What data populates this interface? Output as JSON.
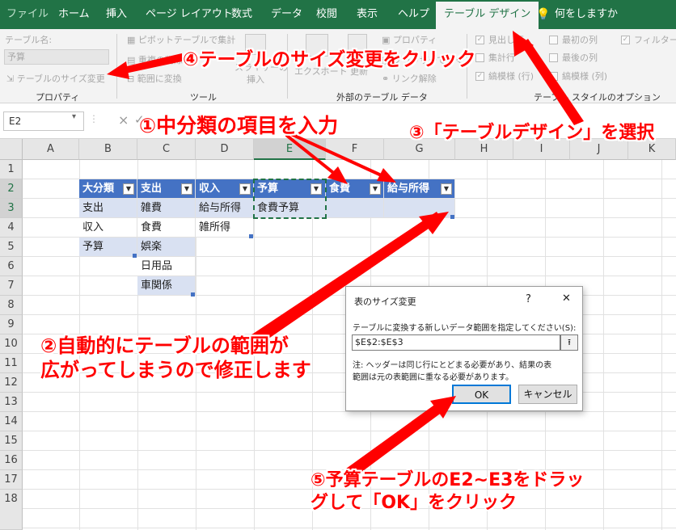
{
  "ribbon": {
    "tabs": [
      "ファイル",
      "ホーム",
      "挿入",
      "ページ レイアウト",
      "数式",
      "データ",
      "校閲",
      "表示",
      "ヘルプ",
      "テーブル デザイン"
    ],
    "tell_me": "何をしますか",
    "table_name_label": "テーブル名:",
    "table_name_value": "予算",
    "resize_label": "テーブルのサイズ変更",
    "group_properties": "プロパティ",
    "pivot_label": "ピボットテーブルで集計",
    "remove_dup_label": "重複の削除",
    "convert_label": "範囲に変換",
    "slicer_label_1": "スライサーの",
    "slicer_label_2": "挿入",
    "group_tools": "ツール",
    "export_label": "エクスポート",
    "refresh_label": "更新",
    "properties_btn": "プロパティ",
    "open_browser_label": "ブラウザーで開く",
    "unlink_label": "リンク解除",
    "group_external": "外部のテーブル データ",
    "opt_header": "見出し行",
    "opt_total": "集計行",
    "opt_banded_rows": "縞模様 (行)",
    "opt_first_col": "最初の列",
    "opt_last_col": "最後の列",
    "opt_banded_cols": "縞模様 (列)",
    "opt_filter": "フィルター ボタン",
    "group_options": "テーブル スタイルのオプション"
  },
  "formula_bar": {
    "name_box": "E2",
    "cancel": "×",
    "confirm": "✓",
    "fx": "fx"
  },
  "grid": {
    "columns": [
      "A",
      "B",
      "C",
      "D",
      "E",
      "F",
      "G",
      "H",
      "I",
      "J",
      "K"
    ],
    "rows": [
      "1",
      "2",
      "3",
      "4",
      "5",
      "6",
      "7",
      "8",
      "9",
      "10",
      "11",
      "12",
      "13",
      "14",
      "15",
      "16",
      "17",
      "18"
    ],
    "cells": {
      "B2": "大分類",
      "C2": "支出",
      "D2": "収入",
      "E2": "予算",
      "F2": "食費",
      "G2": "給与所得",
      "B3": "支出",
      "B4": "収入",
      "B5": "予算",
      "C3": "雑費",
      "C4": "食費",
      "C5": "娯楽",
      "C6": "日用品",
      "C7": "車関係",
      "D3": "給与所得",
      "D4": "雑所得",
      "E3": "食費予算"
    }
  },
  "dialog": {
    "title": "表のサイズ変更",
    "help": "?",
    "close": "✕",
    "prompt": "テーブルに変換する新しいデータ範囲を指定してください(S):",
    "range_value": "$E$2:$E$3",
    "note_line1": "注: ヘッダーは同じ行にとどまる必要があり、結果の表",
    "note_line2": "範囲は元の表範囲に重なる必要があります。",
    "ok": "OK",
    "cancel": "キャンセル"
  },
  "annotations": {
    "step1": "①中分類の項目を入力",
    "step2_line1": "②自動的にテーブルの範囲が",
    "step2_line2": "広がってしまうので修正します",
    "step3": "③「テーブルデザイン」を選択",
    "step4": "④テーブルのサイズ変更をクリック",
    "step5_line1": "⑤予算テーブルのE2~E3をドラッ",
    "step5_line2": "グして「OK」をクリック"
  },
  "colors": {
    "excel_green": "#217346",
    "table_header": "#4472c4",
    "table_band": "#d9e1f2",
    "annotation": "#ff0000"
  }
}
